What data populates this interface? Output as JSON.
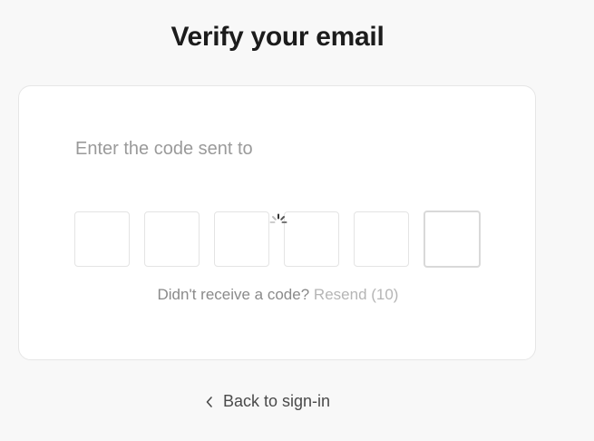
{
  "page": {
    "title": "Verify your email"
  },
  "card": {
    "prompt": "Enter the code sent to",
    "otp_length": 6,
    "resend_prefix": "Didn't receive a code?",
    "resend_label": "Resend (10)"
  },
  "footer": {
    "back_label": "Back to sign-in",
    "back_icon": "chevron-left-icon"
  },
  "colors": {
    "background": "#f8f8f8",
    "title": "#1c1c1c",
    "muted_text": "#8a8a8a",
    "disabled_link": "#b5b5b5"
  }
}
